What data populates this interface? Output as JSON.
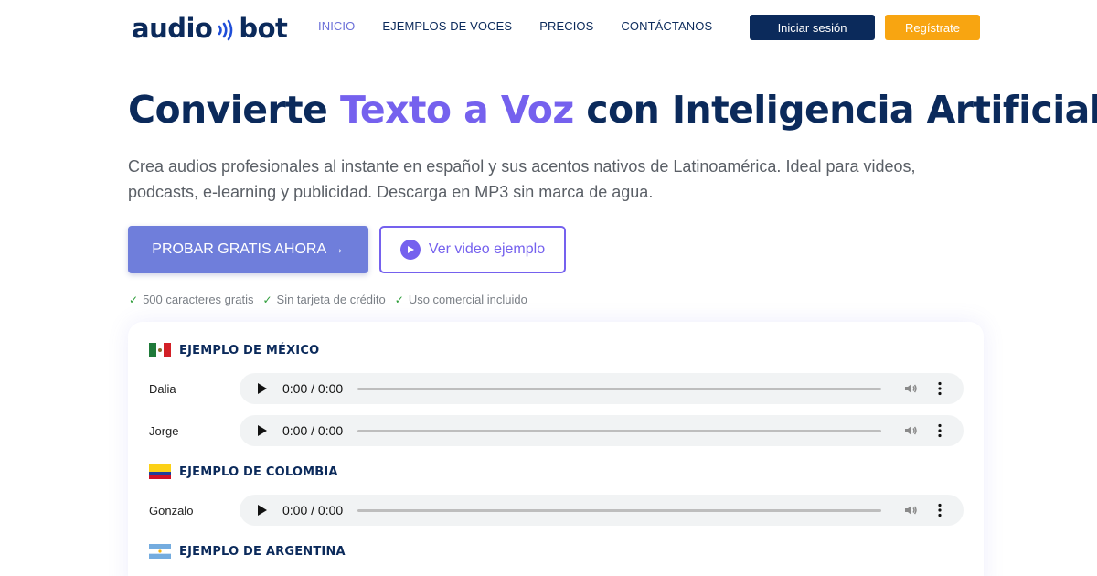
{
  "nav": {
    "logo_left": "audio",
    "logo_right": "bot",
    "links": [
      {
        "label": "INICIO",
        "active": true
      },
      {
        "label": "EJEMPLOS DE VOCES",
        "active": false
      },
      {
        "label": "PRECIOS",
        "active": false
      },
      {
        "label": "CONTÁCTANOS",
        "active": false
      }
    ],
    "login_label": "Iniciar sesión",
    "register_label": "Regístrate"
  },
  "hero": {
    "title_part1": "Convierte ",
    "title_accent": "Texto a Voz",
    "title_part2": " con Inteligencia Artificial",
    "subtitle": "Crea audios profesionales al instante en español y sus acentos nativos de Latinoamérica. Ideal para videos, podcasts, e-learning y publicidad. Descarga en MP3 sin marca de agua.",
    "cta_primary": "PROBAR GRATIS AHORA →",
    "cta_video": "Ver video ejemplo",
    "checks": [
      "500 caracteres gratis",
      "Sin tarjeta de crédito",
      "Uso comercial incluido"
    ],
    "check_glyph": "✓"
  },
  "samples": {
    "mexico": {
      "title": "EJEMPLO DE MÉXICO",
      "voices": [
        {
          "name": "Dalia",
          "time": "0:00 / 0:00"
        },
        {
          "name": "Jorge",
          "time": "0:00 / 0:00"
        }
      ]
    },
    "colombia": {
      "title": "EJEMPLO DE COLOMBIA",
      "voices": [
        {
          "name": "Gonzalo",
          "time": "0:00 / 0:00"
        }
      ]
    },
    "argentina": {
      "title": "EJEMPLO DE ARGENTINA",
      "voices": []
    }
  },
  "colors": {
    "navy": "#0b2a5b",
    "accent_purple": "#7561ee",
    "primary_button": "#6f7edb",
    "register_orange": "#f8a511",
    "check_green": "#2e9d3a"
  }
}
